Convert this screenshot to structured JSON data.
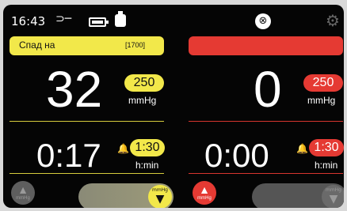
{
  "status_bar": {
    "time": "16:43",
    "icons": [
      "plug-icon",
      "battery-icon",
      "bottle-icon",
      "alarm-mute-icon",
      "gear-icon"
    ]
  },
  "left_panel": {
    "header_label": "Спад на",
    "header_code": "[1700]",
    "pressure_value": "32",
    "pressure_limit": "250",
    "pressure_unit": "mmHg",
    "timer_value": "0:17",
    "timer_limit": "1:30",
    "timer_unit": "h:min",
    "up_button_label": "mmHg",
    "slider_knob_label": "mmHg",
    "accent_color": "#f2e84a"
  },
  "right_panel": {
    "header_label": "",
    "pressure_value": "0",
    "pressure_limit": "250",
    "pressure_unit": "mmHg",
    "timer_value": "0:00",
    "timer_limit": "1:30",
    "timer_unit": "h:min",
    "up_button_label": "mmHg",
    "slider_knob_label": "mmHg",
    "accent_color": "#e53a33"
  }
}
